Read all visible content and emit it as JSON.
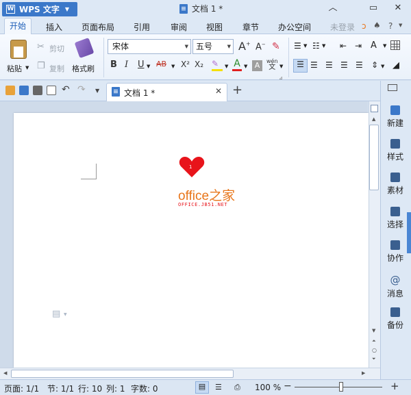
{
  "app": {
    "name": "WPS 文字",
    "doc_title": "文档 1 *"
  },
  "menu": {
    "items": [
      "开始",
      "插入",
      "页面布局",
      "引用",
      "审阅",
      "视图",
      "章节",
      "办公空间"
    ],
    "login": "未登录"
  },
  "ribbon": {
    "paste": "粘贴",
    "cut": "剪切",
    "copy": "复制",
    "format_painter": "格式刷",
    "font_name": "宋体",
    "font_size": "五号",
    "pinyin": "wén"
  },
  "tab": {
    "label": "文档 1 *"
  },
  "document": {
    "heart_number": "1",
    "logo_text": "office之家",
    "logo_url": "OFFICE.JB51.NET"
  },
  "panel": {
    "items": [
      "新建",
      "样式",
      "素材",
      "选择",
      "协作",
      "消息",
      "备份"
    ]
  },
  "status": {
    "page": "页面: 1/1",
    "section": "节: 1/1",
    "line": "行: 10",
    "column": "列: 1",
    "words": "字数: 0",
    "zoom": "100 %"
  },
  "colors": {
    "accent": "#3b78c9",
    "heart": "#e8141b",
    "logo": "#e8761b"
  }
}
